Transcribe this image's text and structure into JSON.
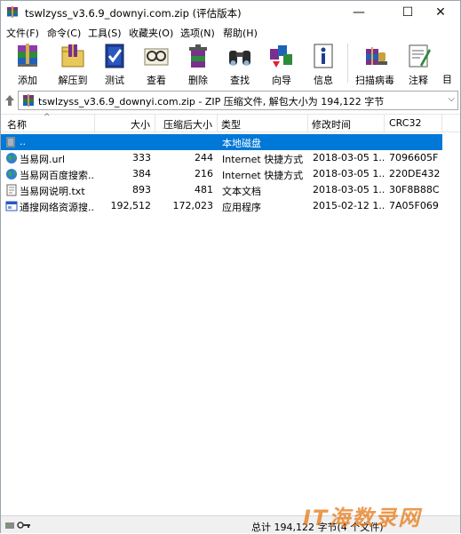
{
  "window": {
    "title": "tswlzyss_v3.6.9_downyi.com.zip (评估版本)",
    "minimize_glyph": "—",
    "maximize_glyph": "☐",
    "close_glyph": "✕"
  },
  "menu": [
    "文件(F)",
    "命令(C)",
    "工具(S)",
    "收藏夹(O)",
    "选项(N)",
    "帮助(H)"
  ],
  "toolbar": {
    "buttons": [
      {
        "label": "添加",
        "icon": "add-archive-icon"
      },
      {
        "label": "解压到",
        "icon": "extract-to-icon"
      },
      {
        "label": "测试",
        "icon": "test-icon"
      },
      {
        "label": "查看",
        "icon": "view-icon"
      },
      {
        "label": "删除",
        "icon": "delete-icon"
      },
      {
        "label": "查找",
        "icon": "find-icon"
      },
      {
        "label": "向导",
        "icon": "wizard-icon"
      },
      {
        "label": "信息",
        "icon": "info-icon"
      },
      {
        "label": "扫描病毒",
        "icon": "scan-virus-icon"
      },
      {
        "label": "注释",
        "icon": "comment-icon"
      }
    ],
    "overflow_label": "目"
  },
  "address": {
    "text": "tswlzyss_v3.6.9_downyi.com.zip - ZIP 压缩文件, 解包大小为 194,122 字节"
  },
  "columns": [
    "名称",
    "大小",
    "压缩后大小",
    "类型",
    "修改时间",
    "CRC32"
  ],
  "files": [
    {
      "name": "..",
      "size": "",
      "packed": "",
      "type": "本地磁盘",
      "modified": "",
      "crc": "",
      "icon": "folder-up-icon",
      "selected": true
    },
    {
      "name": "当易网.url",
      "size": "333",
      "packed": "244",
      "type": "Internet 快捷方式",
      "modified": "2018-03-05 1...",
      "crc": "7096605F",
      "icon": "globe-icon",
      "selected": false
    },
    {
      "name": "当易网百度搜索....",
      "size": "384",
      "packed": "216",
      "type": "Internet 快捷方式",
      "modified": "2018-03-05 1...",
      "crc": "220DE432",
      "icon": "globe-icon",
      "selected": false
    },
    {
      "name": "当易网说明.txt",
      "size": "893",
      "packed": "481",
      "type": "文本文档",
      "modified": "2018-03-05 1...",
      "crc": "30F8B88C",
      "icon": "text-file-icon",
      "selected": false
    },
    {
      "name": "通搜网络资源搜...",
      "size": "192,512",
      "packed": "172,023",
      "type": "应用程序",
      "modified": "2015-02-12 1...",
      "crc": "7A05F069",
      "icon": "application-icon",
      "selected": false
    }
  ],
  "status": {
    "text": "总计 194,122 字节(4 个文件)"
  },
  "watermark": {
    "text": "IT海数录网"
  },
  "colors": {
    "selection": "#0078d7",
    "watermark": "#e67814"
  }
}
